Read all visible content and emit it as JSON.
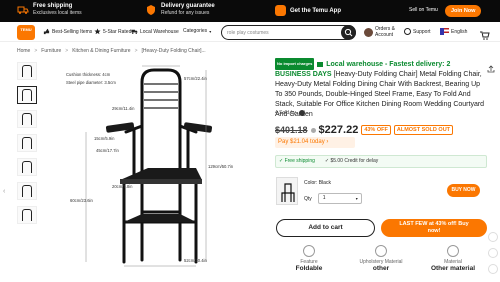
{
  "promo": {
    "free_shipping": "Free shipping",
    "free_shipping_sub": "Exclusives local items",
    "delivery_title": "Delivery guarantee",
    "delivery_sub": "Refund for any issues",
    "app_label": "Get the Temu App",
    "sell": "Sell on Temu",
    "join": "Join Now"
  },
  "nav": {
    "logo": "TEMU",
    "items": [
      "Best-Selling Items",
      "5-Star Rated",
      "Local Warehouse",
      "Categories"
    ],
    "search_placeholder": "role play costumes",
    "orders": "Orders &",
    "orders2": "Account",
    "support": "Support",
    "language": "English"
  },
  "breadcrumb": [
    "Home",
    "Furniture",
    "Kitchen & Dining Furniture",
    "[Heavy-Duty Folding Chair]..."
  ],
  "image_labels": {
    "cushion": "Cushion thickness: 4cm",
    "pipe": "Steel pipe diameter: 3.5cm",
    "w57": "57cm/22.4in",
    "w29": "29cm/11.4in",
    "w15": "15cm/5.9in",
    "w45": "45cm/17.7in",
    "h20": "20cm/7.8in",
    "h129": "129cm/50.7in",
    "h60": "60cm/23.6in",
    "w52": "52cm/20.4in"
  },
  "product": {
    "import_badge": "No import charges",
    "title_green": "Local warehouse - Fastest delivery: 2 BUSINESS DAYS",
    "title_rest": " [Heavy-Duty Folding Chair] Metal Folding Chair, Heavy-Duty Metal Folding Dining Chair With Backrest, Bearing Up To 350 Pounds, Double-Hinged Steel Frame, Easy To Fold And Stack, Suitable For Office Kitchen Dining Room Wedding Courtyard And Garden",
    "sold": "4 Sold by",
    "old_price": "$401.18",
    "new_price": "$227.22",
    "discount": "43% OFF",
    "almost": "ALMOST SOLD OUT",
    "pay_today": "Pay $21.04 today",
    "free_shipping": "✓ Free shipping",
    "credit": "✓ $5.00 Credit for delay",
    "color": "Color: Black",
    "qty_label": "Qty",
    "qty_value": "1",
    "buy_now": "BUY NOW",
    "add_to_cart": "Add to cart",
    "last_few_1": "LAST FEW at 43% off! Buy",
    "last_few_2": "now!"
  },
  "specs": [
    {
      "k": "Feature",
      "v": "Foldable"
    },
    {
      "k": "Upholstery Material",
      "v": "other"
    },
    {
      "k": "Material",
      "v": "Other material"
    }
  ],
  "colors": {
    "accent": "#fb7701",
    "green": "#0a8a2f",
    "dark": "#0a0a0a"
  }
}
